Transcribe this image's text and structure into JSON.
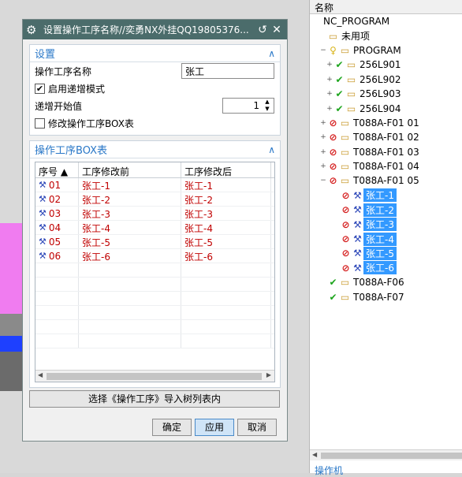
{
  "dialog": {
    "title": "设置操作工序名称//奕勇NX外挂QQ19805376...",
    "settings_section": {
      "header": "设置",
      "op_name_label": "操作工序名称",
      "op_name_value": "张工",
      "enable_increment_label": "启用递增模式",
      "enable_increment_checked": true,
      "increment_start_label": "递增开始值",
      "increment_start_value": "1",
      "modify_box_label": "修改操作工序BOX表",
      "modify_box_checked": false
    },
    "box_section": {
      "header": "操作工序BOX表",
      "columns": [
        "序号",
        "工序修改前",
        "工序修改后"
      ],
      "rows": [
        {
          "idx": "01",
          "before": "张工-1",
          "after": "张工-1"
        },
        {
          "idx": "02",
          "before": "张工-2",
          "after": "张工-2"
        },
        {
          "idx": "03",
          "before": "张工-3",
          "after": "张工-3"
        },
        {
          "idx": "04",
          "before": "张工-4",
          "after": "张工-4"
        },
        {
          "idx": "05",
          "before": "张工-5",
          "after": "张工-5"
        },
        {
          "idx": "06",
          "before": "张工-6",
          "after": "张工-6"
        }
      ]
    },
    "import_button": "选择《操作工序》导入树列表内",
    "ok_button": "确定",
    "apply_button": "应用",
    "cancel_button": "取消"
  },
  "tree": {
    "column_header": "名称",
    "rows": [
      {
        "label": "NC_PROGRAM",
        "indent": 0,
        "expander": "",
        "icons": [],
        "selected": false
      },
      {
        "label": "未用项",
        "indent": 1,
        "expander": "",
        "icons": [
          "folder-icon"
        ],
        "selected": false
      },
      {
        "label": "PROGRAM",
        "indent": 1,
        "expander": "−",
        "icons": [
          "key-icon",
          "folder-icon"
        ],
        "selected": false
      },
      {
        "label": "256L901",
        "indent": 2,
        "expander": "+",
        "icons": [
          "check-icon",
          "folder-icon"
        ],
        "selected": false
      },
      {
        "label": "256L902",
        "indent": 2,
        "expander": "+",
        "icons": [
          "check-icon",
          "folder-icon"
        ],
        "selected": false
      },
      {
        "label": "256L903",
        "indent": 2,
        "expander": "+",
        "icons": [
          "check-icon",
          "folder-icon"
        ],
        "selected": false
      },
      {
        "label": "256L904",
        "indent": 2,
        "expander": "+",
        "icons": [
          "check-icon",
          "folder-icon"
        ],
        "selected": false
      },
      {
        "label": "T088A-F01 01",
        "indent": 1,
        "expander": "+",
        "icons": [
          "block-icon",
          "folder-icon"
        ],
        "selected": false
      },
      {
        "label": "T088A-F01 02",
        "indent": 1,
        "expander": "+",
        "icons": [
          "block-icon",
          "folder-icon"
        ],
        "selected": false
      },
      {
        "label": "T088A-F01 03",
        "indent": 1,
        "expander": "+",
        "icons": [
          "block-icon",
          "folder-icon"
        ],
        "selected": false
      },
      {
        "label": "T088A-F01 04",
        "indent": 1,
        "expander": "+",
        "icons": [
          "block-icon",
          "folder-icon"
        ],
        "selected": false
      },
      {
        "label": "T088A-F01 05",
        "indent": 1,
        "expander": "−",
        "icons": [
          "block-icon",
          "folder-icon"
        ],
        "selected": false
      },
      {
        "label": "张工-1",
        "indent": 3,
        "expander": "",
        "icons": [
          "block-icon",
          "tool-icon"
        ],
        "selected": true
      },
      {
        "label": "张工-2",
        "indent": 3,
        "expander": "",
        "icons": [
          "block-icon",
          "tool-icon"
        ],
        "selected": true
      },
      {
        "label": "张工-3",
        "indent": 3,
        "expander": "",
        "icons": [
          "block-icon",
          "tool-icon"
        ],
        "selected": true
      },
      {
        "label": "张工-4",
        "indent": 3,
        "expander": "",
        "icons": [
          "block-icon",
          "tool-icon"
        ],
        "selected": true
      },
      {
        "label": "张工-5",
        "indent": 3,
        "expander": "",
        "icons": [
          "block-icon",
          "tool-icon"
        ],
        "selected": true
      },
      {
        "label": "张工-6",
        "indent": 3,
        "expander": "",
        "icons": [
          "block-icon",
          "tool-icon"
        ],
        "selected": true
      },
      {
        "label": "T088A-F06",
        "indent": 1,
        "expander": "",
        "icons": [
          "check-icon",
          "folder-icon"
        ],
        "selected": false
      },
      {
        "label": "T088A-F07",
        "indent": 1,
        "expander": "",
        "icons": [
          "check-icon",
          "folder-icon"
        ],
        "selected": false
      }
    ],
    "footer": "操作机"
  },
  "colors": {
    "title_bar": "#4b6c6b",
    "section_header": "#2a78c8",
    "table_text": "#c00000",
    "selection": "#3399ff"
  }
}
